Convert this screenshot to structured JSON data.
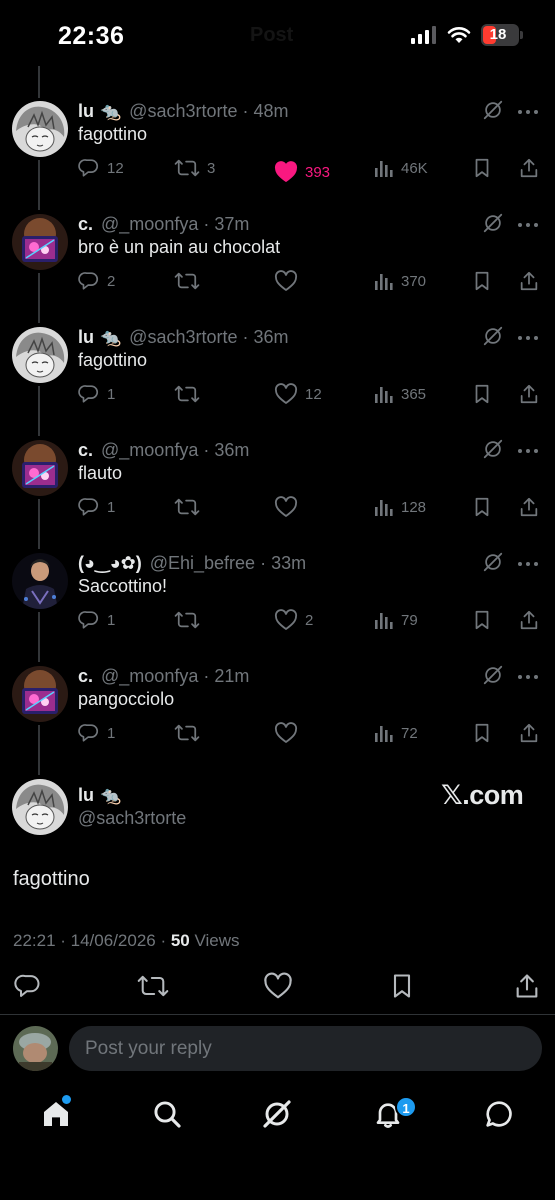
{
  "status_bar": {
    "time": "22:36",
    "ghost_title": "Post",
    "battery": "18"
  },
  "replies": [
    {
      "name": "lu",
      "emoji": "🐀",
      "handle": "@sach3rtorte · 48m",
      "text": "fagottino",
      "reply": "12",
      "repost": "3",
      "like": "393",
      "liked": true,
      "views": "46K"
    },
    {
      "name": "c.",
      "emoji": "",
      "handle": "@_moonfya · 37m",
      "text": "bro è un pain au chocolat",
      "reply": "2",
      "repost": "",
      "like": "",
      "liked": false,
      "views": "370"
    },
    {
      "name": "lu",
      "emoji": "🐀",
      "handle": "@sach3rtorte · 36m",
      "text": "fagottino",
      "reply": "1",
      "repost": "",
      "like": "12",
      "liked": false,
      "views": "365"
    },
    {
      "name": "c.",
      "emoji": "",
      "handle": "@_moonfya · 36m",
      "text": "flauto",
      "reply": "1",
      "repost": "",
      "like": "",
      "liked": false,
      "views": "128"
    },
    {
      "name": "(◕‿◕✿)",
      "emoji": "",
      "handle": "@Ehi_befree · 33m",
      "text": "Saccottino!",
      "reply": "1",
      "repost": "",
      "like": "2",
      "liked": false,
      "views": "79"
    },
    {
      "name": "c.",
      "emoji": "",
      "handle": "@_moonfya · 21m",
      "text": "pangocciolo",
      "reply": "1",
      "repost": "",
      "like": "",
      "liked": false,
      "views": "72"
    }
  ],
  "main_tweet": {
    "name": "lu",
    "emoji": "🐀",
    "handle": "@sach3rtorte",
    "watermark": "𝕏.com",
    "text": "fagottino",
    "timestamp": "22:21 · 14/06/2026 · ",
    "views_count": "50",
    "views_label": " Views"
  },
  "composer": {
    "placeholder": "Post your reply"
  },
  "nav": {
    "notifications_badge": "1"
  },
  "colors": {
    "background": "#000000",
    "text": "#e7e9ea",
    "muted": "#71767b",
    "like": "#f91880",
    "accent": "#1d9bf0"
  }
}
